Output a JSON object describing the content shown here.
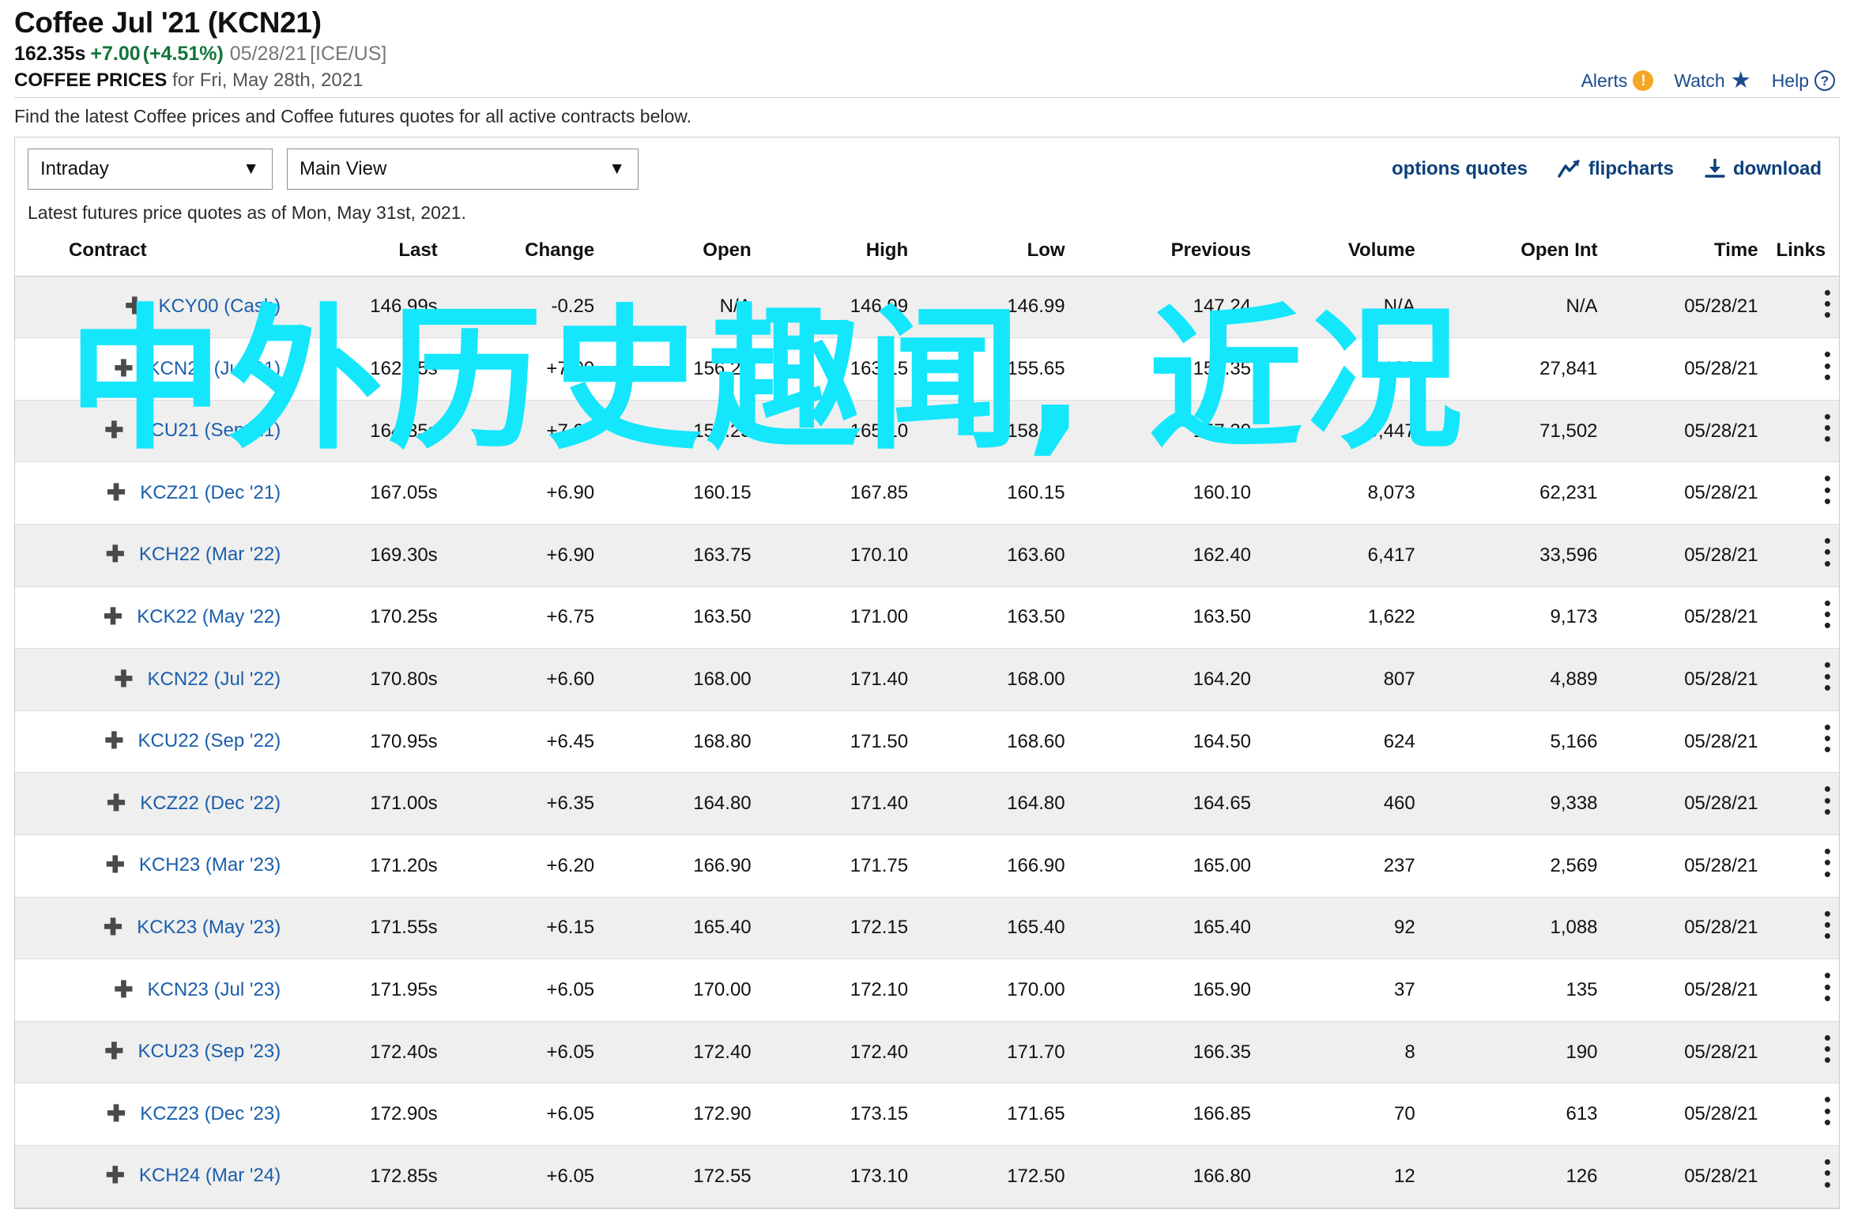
{
  "header": {
    "title": "Coffee Jul '21 (KCN21)",
    "last_price": "162.35s",
    "change": "+7.00",
    "change_pct": "(+4.51%)",
    "quote_date": "05/28/21",
    "exchange": "[ICE/US]",
    "subhead_strong": "COFFEE PRICES",
    "subhead_rest": "for Fri, May 28th, 2021",
    "links": [
      {
        "label": "Alerts",
        "icon": "alert-exclamation-icon"
      },
      {
        "label": "Watch",
        "icon": "star-icon"
      },
      {
        "label": "Help",
        "icon": "help-question-icon"
      }
    ],
    "accent_blue": "#1a4b8c",
    "accent_orange": "#f5a623",
    "up_green": "#11763b",
    "down_red": "#c8102e"
  },
  "intro": {
    "find_text": "Find the latest Coffee prices and Coffee futures quotes for all active contracts below."
  },
  "toolbar": {
    "view_select": {
      "value": "Intraday",
      "icon": "chevron-down-icon"
    },
    "layout_select": {
      "value": "Main View",
      "icon": "chevron-down-icon"
    },
    "options_quotes_label": "options quotes",
    "flipcharts_label": "flipcharts",
    "download_label": "download",
    "latest_text": "Latest futures price quotes as of Mon, May 31st, 2021."
  },
  "table": {
    "columns": [
      "Contract",
      "Last",
      "Change",
      "Open",
      "High",
      "Low",
      "Previous",
      "Volume",
      "Open Int",
      "Time",
      "Links"
    ],
    "rows": [
      {
        "contract": "KCY00 (Cash)",
        "last": "146.99s",
        "change": "-0.25",
        "dir": "down",
        "open": "N/A",
        "high": "146.99",
        "low": "146.99",
        "previous": "147.24",
        "volume": "N/A",
        "open_int": "N/A",
        "time": "05/28/21"
      },
      {
        "contract": "KCN21 (Jul '21)",
        "last": "162.35s",
        "change": "+7.00",
        "dir": "up",
        "open": "156.25",
        "high": "163.15",
        "low": "155.65",
        "previous": "155.35",
        "volume": "8,123",
        "open_int": "27,841",
        "time": "05/28/21"
      },
      {
        "contract": "KCU21 (Sep '21)",
        "last": "164.35s",
        "change": "+7.05",
        "dir": "up",
        "open": "158.25",
        "high": "165.10",
        "low": "158.20",
        "previous": "157.30",
        "volume": "9,447",
        "open_int": "71,502",
        "time": "05/28/21"
      },
      {
        "contract": "KCZ21 (Dec '21)",
        "last": "167.05s",
        "change": "+6.90",
        "dir": "up",
        "open": "160.15",
        "high": "167.85",
        "low": "160.15",
        "previous": "160.10",
        "volume": "8,073",
        "open_int": "62,231",
        "time": "05/28/21"
      },
      {
        "contract": "KCH22 (Mar '22)",
        "last": "169.30s",
        "change": "+6.90",
        "dir": "up",
        "open": "163.75",
        "high": "170.10",
        "low": "163.60",
        "previous": "162.40",
        "volume": "6,417",
        "open_int": "33,596",
        "time": "05/28/21"
      },
      {
        "contract": "KCK22 (May '22)",
        "last": "170.25s",
        "change": "+6.75",
        "dir": "up",
        "open": "163.50",
        "high": "171.00",
        "low": "163.50",
        "previous": "163.50",
        "volume": "1,622",
        "open_int": "9,173",
        "time": "05/28/21"
      },
      {
        "contract": "KCN22 (Jul '22)",
        "last": "170.80s",
        "change": "+6.60",
        "dir": "up",
        "open": "168.00",
        "high": "171.40",
        "low": "168.00",
        "previous": "164.20",
        "volume": "807",
        "open_int": "4,889",
        "time": "05/28/21"
      },
      {
        "contract": "KCU22 (Sep '22)",
        "last": "170.95s",
        "change": "+6.45",
        "dir": "up",
        "open": "168.80",
        "high": "171.50",
        "low": "168.60",
        "previous": "164.50",
        "volume": "624",
        "open_int": "5,166",
        "time": "05/28/21"
      },
      {
        "contract": "KCZ22 (Dec '22)",
        "last": "171.00s",
        "change": "+6.35",
        "dir": "up",
        "open": "164.80",
        "high": "171.40",
        "low": "164.80",
        "previous": "164.65",
        "volume": "460",
        "open_int": "9,338",
        "time": "05/28/21"
      },
      {
        "contract": "KCH23 (Mar '23)",
        "last": "171.20s",
        "change": "+6.20",
        "dir": "up",
        "open": "166.90",
        "high": "171.75",
        "low": "166.90",
        "previous": "165.00",
        "volume": "237",
        "open_int": "2,569",
        "time": "05/28/21"
      },
      {
        "contract": "KCK23 (May '23)",
        "last": "171.55s",
        "change": "+6.15",
        "dir": "up",
        "open": "165.40",
        "high": "172.15",
        "low": "165.40",
        "previous": "165.40",
        "volume": "92",
        "open_int": "1,088",
        "time": "05/28/21"
      },
      {
        "contract": "KCN23 (Jul '23)",
        "last": "171.95s",
        "change": "+6.05",
        "dir": "up",
        "open": "170.00",
        "high": "172.10",
        "low": "170.00",
        "previous": "165.90",
        "volume": "37",
        "open_int": "135",
        "time": "05/28/21"
      },
      {
        "contract": "KCU23 (Sep '23)",
        "last": "172.40s",
        "change": "+6.05",
        "dir": "up",
        "open": "172.40",
        "high": "172.40",
        "low": "171.70",
        "previous": "166.35",
        "volume": "8",
        "open_int": "190",
        "time": "05/28/21"
      },
      {
        "contract": "KCZ23 (Dec '23)",
        "last": "172.90s",
        "change": "+6.05",
        "dir": "up",
        "open": "172.90",
        "high": "173.15",
        "low": "171.65",
        "previous": "166.85",
        "volume": "70",
        "open_int": "613",
        "time": "05/28/21"
      },
      {
        "contract": "KCH24 (Mar '24)",
        "last": "172.85s",
        "change": "+6.05",
        "dir": "up",
        "open": "172.55",
        "high": "173.10",
        "low": "172.50",
        "previous": "166.80",
        "volume": "12",
        "open_int": "126",
        "time": "05/28/21"
      }
    ]
  },
  "overlay": {
    "text": "中外历史趣闻, 近况",
    "color": "#14E6FC"
  }
}
